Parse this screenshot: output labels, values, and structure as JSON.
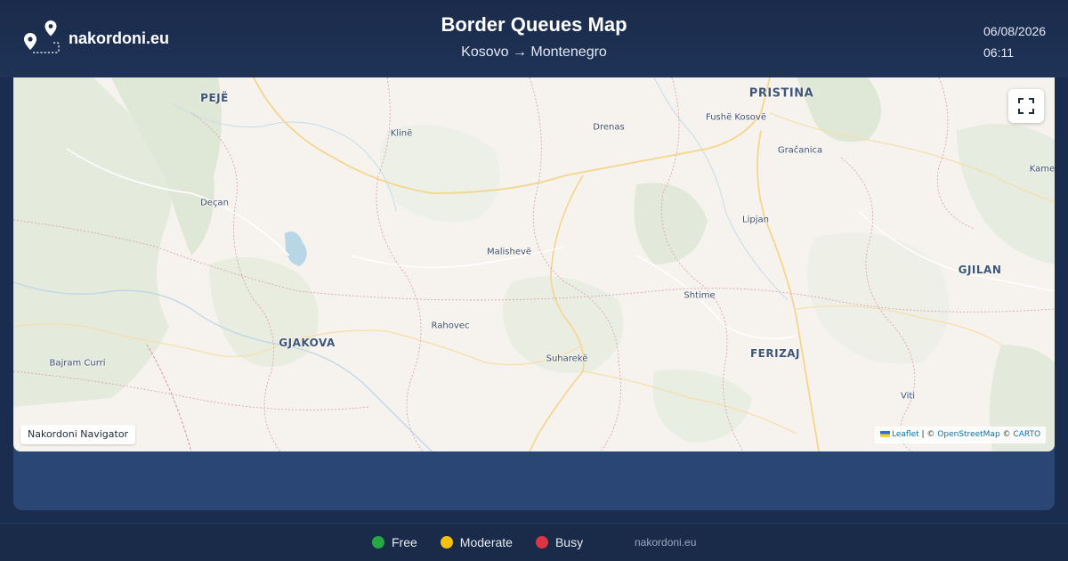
{
  "header": {
    "brand_name": "nakordoni.eu",
    "title": "Border Queues Map",
    "subtitle": "Kosovo → Montenegro",
    "date": "06/08/2026",
    "time": "06:11"
  },
  "map": {
    "places": [
      {
        "name": "PEJË",
        "kind": "city"
      },
      {
        "name": "PRISTINA",
        "kind": "city-large"
      },
      {
        "name": "Fushë Kosovë",
        "kind": "town"
      },
      {
        "name": "Klinë",
        "kind": "town"
      },
      {
        "name": "Drenas",
        "kind": "town"
      },
      {
        "name": "Gračanica",
        "kind": "town"
      },
      {
        "name": "Kame",
        "kind": "town"
      },
      {
        "name": "Deçan",
        "kind": "town"
      },
      {
        "name": "Lipjan",
        "kind": "town"
      },
      {
        "name": "Malishevë",
        "kind": "town"
      },
      {
        "name": "GJILAN",
        "kind": "city"
      },
      {
        "name": "Shtime",
        "kind": "town"
      },
      {
        "name": "Rahovec",
        "kind": "town"
      },
      {
        "name": "GJAKOVA",
        "kind": "city"
      },
      {
        "name": "FERIZAJ",
        "kind": "city"
      },
      {
        "name": "Bajram Curri",
        "kind": "town"
      },
      {
        "name": "Suharekë",
        "kind": "town"
      },
      {
        "name": "Viti",
        "kind": "town"
      }
    ],
    "navigator_label": "Nakordoni Navigator",
    "attribution": {
      "leaflet": "Leaflet",
      "sep1": " | © ",
      "osm": "OpenStreetMap",
      "sep2": " © ",
      "carto": "CARTO"
    },
    "fullscreen_icon": "fullscreen-icon"
  },
  "legend": [
    {
      "label": "Free",
      "color": "#28a745"
    },
    {
      "label": "Moderate",
      "color": "#f4c20d"
    },
    {
      "label": "Busy",
      "color": "#dc3545"
    }
  ],
  "footer": {
    "site": "nakordoni.eu"
  },
  "colors": {
    "header_bg": "#1b2b4b",
    "panel_bg": "#2a4674",
    "map_bg": "#f6f3ee"
  }
}
